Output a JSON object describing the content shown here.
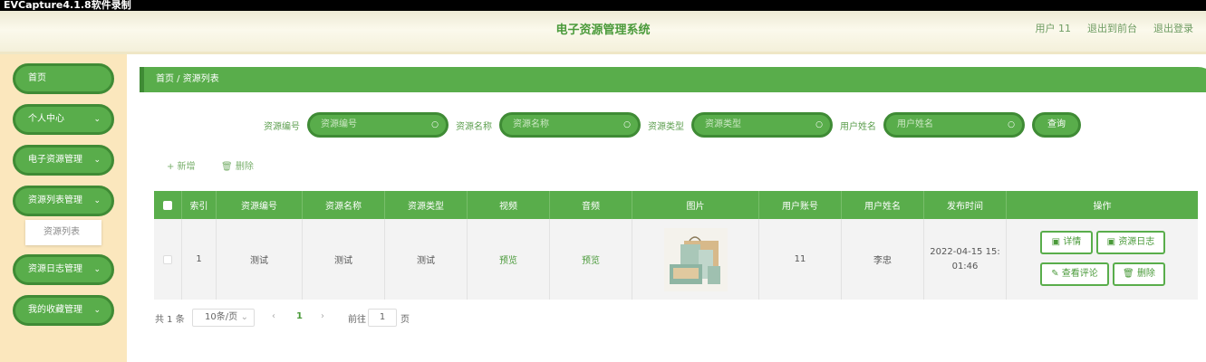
{
  "capture_banner": "EVCapture4.1.8软件录制",
  "header": {
    "title": "电子资源管理系统",
    "user": "用户 11",
    "to_front": "退出到前台",
    "logout": "退出登录"
  },
  "sidebar": {
    "items": [
      {
        "label": "首页",
        "has_chevron": false
      },
      {
        "label": "个人中心",
        "has_chevron": true
      },
      {
        "label": "电子资源管理",
        "has_chevron": true
      },
      {
        "label": "资源列表管理",
        "has_chevron": true
      },
      {
        "label": "资源日志管理",
        "has_chevron": true
      },
      {
        "label": "我的收藏管理",
        "has_chevron": true
      }
    ],
    "submenu_item": "资源列表",
    "chevron": "⌄"
  },
  "breadcrumb": "首页 / 资源列表",
  "search": {
    "fields": [
      {
        "label": "资源编号",
        "placeholder": "资源编号"
      },
      {
        "label": "资源名称",
        "placeholder": "资源名称"
      },
      {
        "label": "资源类型",
        "placeholder": "资源类型"
      },
      {
        "label": "用户姓名",
        "placeholder": "用户姓名"
      }
    ],
    "search_icon": "search-icon",
    "query_button": "查询"
  },
  "actions": {
    "add": "+ 新增",
    "delete": "删除"
  },
  "table": {
    "headers": [
      "索引",
      "资源编号",
      "资源名称",
      "资源类型",
      "视频",
      "音频",
      "图片",
      "用户账号",
      "用户姓名",
      "发布时间",
      "操作"
    ],
    "rows": [
      {
        "index": "1",
        "code": "测试",
        "name": "测试",
        "type": "测试",
        "video": "预览",
        "audio": "预览",
        "account": "11",
        "username": "李忠",
        "time_line1": "2022-04-15 15:",
        "time_line2": "01:46",
        "buttons": {
          "detail": "详情",
          "log": "资源日志",
          "comment": "查看评论",
          "delete": "删除"
        }
      }
    ]
  },
  "pagination": {
    "total": "共 1 条",
    "page_size": "10条/页",
    "current": "1",
    "goto_prefix": "前往",
    "goto_value": "1",
    "goto_suffix": "页",
    "prev": "‹",
    "next": "›"
  },
  "colors": {
    "primary": "#59ad4b",
    "primary_dark": "#3f8b35",
    "sidebar_bg": "#fbe7bd"
  }
}
